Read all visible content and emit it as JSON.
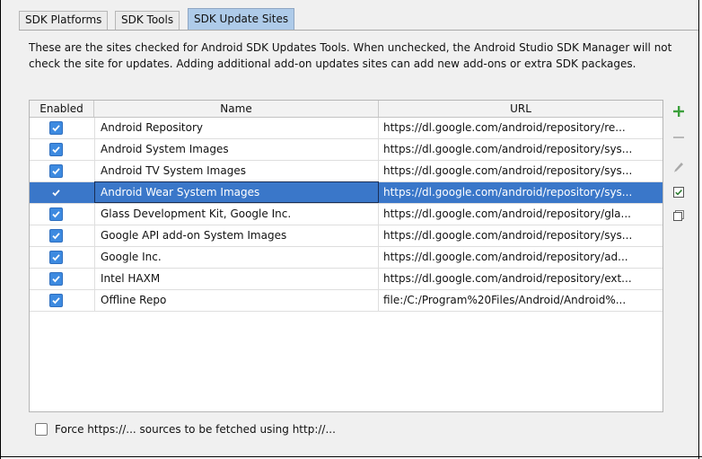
{
  "tabs": [
    {
      "label": "SDK Platforms",
      "active": false
    },
    {
      "label": "SDK Tools",
      "active": false
    },
    {
      "label": "SDK Update Sites",
      "active": true
    }
  ],
  "description": "These are the sites checked for Android SDK Updates Tools. When unchecked, the Android Studio SDK Manager will not check the site for updates. Adding additional add-on updates sites can add new add-ons or extra SDK packages.",
  "table": {
    "headers": {
      "enabled": "Enabled",
      "name": "Name",
      "url": "URL"
    },
    "selected_index": 3,
    "rows": [
      {
        "enabled": true,
        "name": "Android Repository",
        "url": "https://dl.google.com/android/repository/re..."
      },
      {
        "enabled": true,
        "name": "Android System Images",
        "url": "https://dl.google.com/android/repository/sys..."
      },
      {
        "enabled": true,
        "name": "Android TV System Images",
        "url": "https://dl.google.com/android/repository/sys..."
      },
      {
        "enabled": true,
        "name": "Android Wear System Images",
        "url": "https://dl.google.com/android/repository/sys..."
      },
      {
        "enabled": true,
        "name": "Glass Development Kit, Google Inc.",
        "url": "https://dl.google.com/android/repository/gla..."
      },
      {
        "enabled": true,
        "name": "Google API add-on System Images",
        "url": "https://dl.google.com/android/repository/sys..."
      },
      {
        "enabled": true,
        "name": "Google Inc.",
        "url": "https://dl.google.com/android/repository/ad..."
      },
      {
        "enabled": true,
        "name": "Intel HAXM",
        "url": "https://dl.google.com/android/repository/ext..."
      },
      {
        "enabled": true,
        "name": "Offline Repo",
        "url": "file:/C:/Program%20Files/Android/Android%..."
      }
    ]
  },
  "toolbar": {
    "add_icon": "plus-icon",
    "remove_icon": "minus-icon",
    "edit_icon": "pencil-icon",
    "select_all_icon": "checked-box-icon",
    "deselect_all_icon": "unchecked-box-icon"
  },
  "force_http": {
    "checked": false,
    "label": "Force https://... sources to be fetched using http://..."
  },
  "colors": {
    "active_tab": "#aecbe9",
    "selection": "#3a77c9",
    "checkbox": "#3d8ae0",
    "add_green": "#3ca03c"
  }
}
